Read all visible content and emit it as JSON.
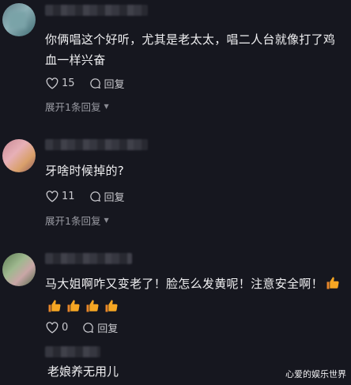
{
  "comments": [
    {
      "text": "你俩唱这个好听，尤其是老太太，唱二人台就像打了鸡血一样兴奋",
      "likes": "15",
      "reply_label": "回复",
      "expand_label": "展开1条回复"
    },
    {
      "text": "牙啥时候掉的?",
      "likes": "11",
      "reply_label": "回复",
      "expand_label": "展开1条回复"
    },
    {
      "text": "马大姐啊咋又变老了！脸怎么发黄呢！注意安全啊！",
      "likes": "0",
      "reply_label": "回复"
    }
  ],
  "bottom_text": "老娘养无用儿",
  "watermark": "心爱的娱乐世界",
  "icons": [
    "heart-icon",
    "comment-icon",
    "thumbs-up-icon"
  ],
  "colors": {
    "background": "#16171f",
    "thumb": "#f5a623"
  }
}
